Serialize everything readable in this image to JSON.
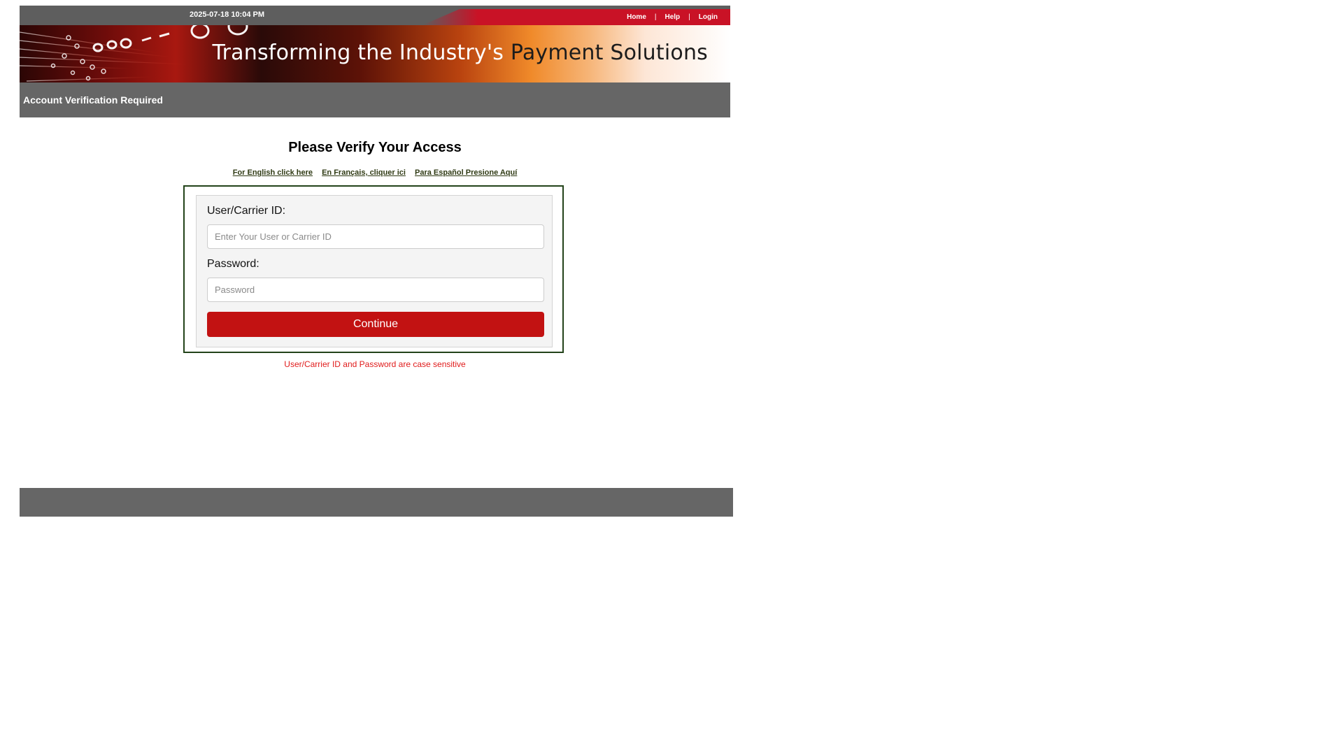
{
  "header": {
    "datetime": "2025-07-18 10:04 PM",
    "nav": {
      "home": "Home",
      "help": "Help",
      "login": "Login",
      "separator": "|"
    }
  },
  "banner": {
    "tagline_part1": "Transforming the Industry's ",
    "tagline_part2": "Payment Solutions"
  },
  "titlebar": {
    "text": "Account Verification Required"
  },
  "main": {
    "heading": "Please Verify Your Access",
    "languages": {
      "english": "For English click here",
      "french": "En Français, cliquer ici",
      "spanish": "Para Español Presione Aquí"
    },
    "form": {
      "user_label": "User/Carrier ID:",
      "user_placeholder": "Enter Your User or Carrier ID",
      "user_value": "",
      "password_label": "Password:",
      "password_placeholder": "Password",
      "password_value": "",
      "continue_label": "Continue"
    },
    "note": "User/Carrier ID and Password are case sensitive"
  },
  "colors": {
    "accent_red": "#c21212",
    "header_gray": "#5e5e5e",
    "titlebar_gray": "#666666",
    "form_border": "#23431a",
    "link_color": "#2f3a14",
    "note_red": "#e01b1b"
  }
}
